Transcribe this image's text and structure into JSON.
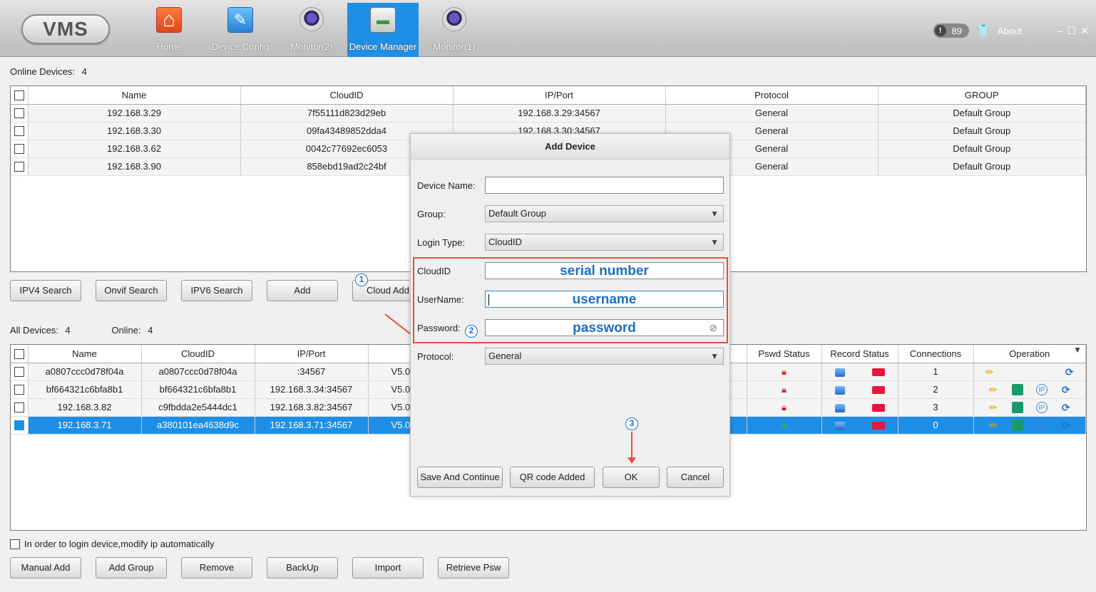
{
  "app": {
    "logo": "VMS"
  },
  "nav": [
    {
      "label": "Home",
      "icon": "home-icon"
    },
    {
      "label": "Device Config",
      "icon": "config-icon"
    },
    {
      "label": "Monitor(2)",
      "icon": "camera-icon"
    },
    {
      "label": "Device Manager",
      "icon": "device-icon",
      "active": true
    },
    {
      "label": "Monitor(1)",
      "icon": "camera-icon"
    }
  ],
  "topright": {
    "notifications": "89",
    "about": "About",
    "minimize": "–",
    "maximize": "☐",
    "close": "✕"
  },
  "online": {
    "label": "Online Devices:",
    "count": "4",
    "columns": [
      "Name",
      "CloudID",
      "IP/Port",
      "Protocol",
      "GROUP"
    ],
    "rows": [
      [
        "192.168.3.29",
        "7f55111d823d29eb",
        "192.168.3.29:34567",
        "General",
        "Default Group"
      ],
      [
        "192.168.3.30",
        "09fa43489852dda4",
        "192.168.3.30:34567",
        "General",
        "Default Group"
      ],
      [
        "192.168.3.62",
        "0042c77692ec6053",
        "",
        "General",
        "Default Group"
      ],
      [
        "192.168.3.90",
        "858ebd19ad2c24bf",
        "",
        "General",
        "Default Group"
      ]
    ]
  },
  "search_buttons": [
    "IPV4 Search",
    "Onvif Search",
    "IPV6 Search",
    "Add",
    "Cloud Add"
  ],
  "all": {
    "label": "All Devices:",
    "count": "4",
    "online_label": "Online:",
    "online_count": "4",
    "columns": [
      "Name",
      "CloudID",
      "IP/Port",
      "",
      "Pswd Status",
      "Record Status",
      "Connections",
      "Operation"
    ],
    "rows": [
      [
        "a0807ccc0d78f04a",
        "a0807ccc0d78f04a",
        ":34567",
        "V5.0",
        "1"
      ],
      [
        "bf664321c6bfa8b1",
        "bf664321c6bfa8b1",
        "192.168.3.34:34567",
        "V5.0",
        "2"
      ],
      [
        "192.168.3.82",
        "c9fbdda2e5444dc1",
        "192.168.3.82:34567",
        "V5.0",
        "3"
      ],
      [
        "192.168.3.71",
        "a380101ea4638d9c",
        "192.168.3.71:34567",
        "V5.0",
        "0"
      ]
    ]
  },
  "auto_ip_label": "In order to login device,modify ip automatically",
  "bottom_buttons": [
    "Manual Add",
    "Add Group",
    "Remove",
    "BackUp",
    "Import",
    "Retrieve Psw"
  ],
  "dialog": {
    "title": "Add Device",
    "device_name_label": "Device Name:",
    "device_name_value": "",
    "group_label": "Group:",
    "group_value": "Default Group",
    "login_type_label": "Login Type:",
    "login_type_value": "CloudID",
    "cloudid_label": "CloudID",
    "cloudid_hint": "serial number",
    "username_label": "UserName:",
    "username_hint": "username",
    "password_label": "Password:",
    "password_hint": "password",
    "protocol_label": "Protocol:",
    "protocol_value": "General",
    "buttons": [
      "Save And Continue",
      "QR code Added",
      "OK",
      "Cancel"
    ]
  },
  "steps": [
    "1",
    "2",
    "3"
  ],
  "colors": {
    "accent": "#1e8fe6",
    "annotation": "#e84d3d",
    "hint": "#1a6fc4"
  }
}
